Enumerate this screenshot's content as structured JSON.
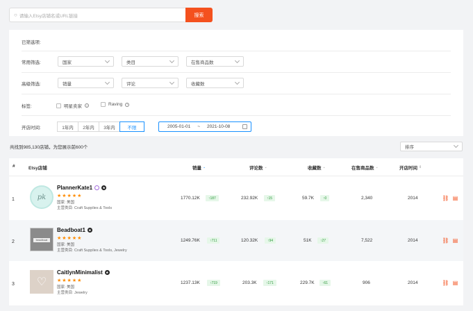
{
  "search": {
    "placeholder": "请输入Etsy店铺名或URL链接",
    "button": "搜索"
  },
  "filters": {
    "selected_label": "已筛选项:",
    "common_label": "常用筛选:",
    "common": [
      "国家",
      "类目",
      "在售商品数"
    ],
    "advanced_label": "高级筛选:",
    "advanced": [
      "销量",
      "评论",
      "收藏数"
    ],
    "tags_label": "标签:",
    "tags": [
      "明星卖家",
      "Raving"
    ],
    "open_label": "开店时间:",
    "open_options": [
      "1年内",
      "2年内",
      "3年内",
      "不限"
    ],
    "date_start": "2005-01-01",
    "date_sep": "~",
    "date_end": "2021-10-08"
  },
  "results": {
    "count_text": "共找到985,130店铺，为您展示前600个",
    "sort": "排序"
  },
  "table": {
    "headers": [
      "#",
      "Etsy店铺",
      "销量",
      "评论数",
      "收藏数",
      "在售商品数",
      "开店时间"
    ],
    "rows": [
      {
        "rank": "1",
        "name": "PlannerKate1",
        "country": "国家: 美国",
        "category": "主营类目: Craft Supplies & Tools",
        "sales": "1770.12K",
        "sales_up": "↑187",
        "reviews": "232.92K",
        "reviews_up": "↑15",
        "favs": "59.7K",
        "favs_up": "↑0",
        "listings": "2,340",
        "year": "2014"
      },
      {
        "rank": "2",
        "name": "Beadboat1",
        "country": "国家: 美国",
        "category": "主营类目: Craft Supplies & Tools, Jewelry",
        "sales": "1249.76K",
        "sales_up": "↑711",
        "reviews": "120.32K",
        "reviews_up": "↑94",
        "favs": "51K",
        "favs_up": "↑27",
        "listings": "7,522",
        "year": "2014"
      },
      {
        "rank": "3",
        "name": "CaitlynMinimalist",
        "country": "国家: 美国",
        "category": "主营类目: Jewelry",
        "sales": "1237.13K",
        "sales_up": "↑719",
        "reviews": "203.3K",
        "reviews_up": "↑171",
        "favs": "229.7K",
        "favs_up": "↑61",
        "listings": "906",
        "year": "2014"
      }
    ],
    "stars": "★★★★★",
    "logo2_text": "beadboat"
  },
  "colors": {
    "accent": "#f4511e",
    "blue": "#1890ff",
    "star": "#ff8c00",
    "green": "#2e9b3c"
  }
}
